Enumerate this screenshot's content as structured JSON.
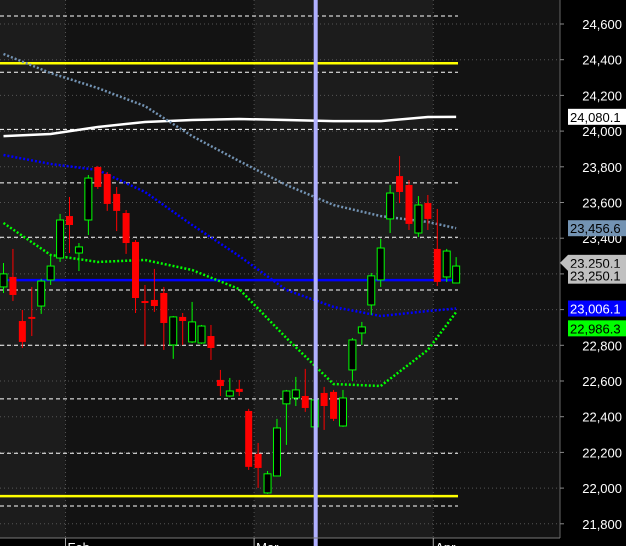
{
  "chart_data": {
    "type": "candlestick",
    "title": "",
    "xlabel": "",
    "ylabel": "",
    "ylim": [
      21730,
      24735
    ],
    "y_ticks": [
      "24,600",
      "24,400",
      "24,200",
      "24,000",
      "23,800",
      "23,600",
      "23,400",
      "23,200",
      "23,000",
      "22,800",
      "22,600",
      "22,400",
      "22,200",
      "22,000",
      "21,800"
    ],
    "y_tick_values": [
      24600,
      24400,
      24200,
      24000,
      23800,
      23600,
      23400,
      23200,
      23000,
      22800,
      22600,
      22400,
      22200,
      22000,
      21800
    ],
    "month_labels": [
      {
        "label": "Feb",
        "index": 7
      },
      {
        "label": "Mar",
        "index": 27
      },
      {
        "label": "Apr",
        "index": 46
      }
    ],
    "candles": [
      {
        "o": 23127,
        "h": 23261,
        "l": 23093,
        "c": 23200
      },
      {
        "o": 23183,
        "h": 23340,
        "l": 23048,
        "c": 23082
      },
      {
        "o": 22936,
        "h": 22998,
        "l": 22785,
        "c": 22819
      },
      {
        "o": 22959,
        "h": 23127,
        "l": 22852,
        "c": 22948
      },
      {
        "o": 23020,
        "h": 23172,
        "l": 22976,
        "c": 23160
      },
      {
        "o": 23166,
        "h": 23306,
        "l": 23138,
        "c": 23244
      },
      {
        "o": 23289,
        "h": 23536,
        "l": 23267,
        "c": 23502
      },
      {
        "o": 23524,
        "h": 23631,
        "l": 23317,
        "c": 23474
      },
      {
        "o": 23317,
        "h": 23373,
        "l": 23216,
        "c": 23351
      },
      {
        "o": 23502,
        "h": 23754,
        "l": 23418,
        "c": 23737
      },
      {
        "o": 23799,
        "h": 23805,
        "l": 23676,
        "c": 23687
      },
      {
        "o": 23760,
        "h": 23771,
        "l": 23553,
        "c": 23592
      },
      {
        "o": 23648,
        "h": 23687,
        "l": 23440,
        "c": 23553
      },
      {
        "o": 23541,
        "h": 23558,
        "l": 23312,
        "c": 23373
      },
      {
        "o": 23379,
        "h": 23390,
        "l": 22981,
        "c": 23065
      },
      {
        "o": 23048,
        "h": 23138,
        "l": 22796,
        "c": 23037
      },
      {
        "o": 23054,
        "h": 23228,
        "l": 22987,
        "c": 23020
      },
      {
        "o": 23093,
        "h": 23127,
        "l": 22774,
        "c": 22925
      },
      {
        "o": 22802,
        "h": 22964,
        "l": 22724,
        "c": 22959
      },
      {
        "o": 22959,
        "h": 22981,
        "l": 22802,
        "c": 22936
      },
      {
        "o": 22819,
        "h": 23043,
        "l": 22813,
        "c": 22931
      },
      {
        "o": 22813,
        "h": 22914,
        "l": 22808,
        "c": 22908
      },
      {
        "o": 22852,
        "h": 22914,
        "l": 22718,
        "c": 22785
      },
      {
        "o": 22606,
        "h": 22662,
        "l": 22516,
        "c": 22572
      },
      {
        "o": 22516,
        "h": 22617,
        "l": 22511,
        "c": 22544
      },
      {
        "o": 22556,
        "h": 22606,
        "l": 22516,
        "c": 22539
      },
      {
        "o": 22432,
        "h": 22444,
        "l": 22102,
        "c": 22119
      },
      {
        "o": 22192,
        "h": 22253,
        "l": 22001,
        "c": 22113
      },
      {
        "o": 21973,
        "h": 22096,
        "l": 21968,
        "c": 22080
      },
      {
        "o": 22068,
        "h": 22388,
        "l": 22068,
        "c": 22337
      },
      {
        "o": 22472,
        "h": 22550,
        "l": 22242,
        "c": 22544
      },
      {
        "o": 22505,
        "h": 22623,
        "l": 22460,
        "c": 22550
      },
      {
        "o": 22516,
        "h": 22668,
        "l": 22427,
        "c": 22449
      },
      {
        "o": 22343,
        "h": 22516,
        "l": 22315,
        "c": 22494
      },
      {
        "o": 22533,
        "h": 22567,
        "l": 22326,
        "c": 22460
      },
      {
        "o": 22539,
        "h": 22550,
        "l": 22376,
        "c": 22388
      },
      {
        "o": 22348,
        "h": 22550,
        "l": 22343,
        "c": 22505
      },
      {
        "o": 22662,
        "h": 22841,
        "l": 22600,
        "c": 22830
      },
      {
        "o": 22869,
        "h": 22931,
        "l": 22802,
        "c": 22903
      },
      {
        "o": 23026,
        "h": 23205,
        "l": 22970,
        "c": 23189
      },
      {
        "o": 23166,
        "h": 23396,
        "l": 23127,
        "c": 23345
      },
      {
        "o": 23508,
        "h": 23698,
        "l": 23429,
        "c": 23653
      },
      {
        "o": 23748,
        "h": 23860,
        "l": 23597,
        "c": 23659
      },
      {
        "o": 23698,
        "h": 23726,
        "l": 23446,
        "c": 23480
      },
      {
        "o": 23429,
        "h": 23636,
        "l": 23407,
        "c": 23586
      },
      {
        "o": 23597,
        "h": 23642,
        "l": 23446,
        "c": 23508
      },
      {
        "o": 23340,
        "h": 23564,
        "l": 23132,
        "c": 23155
      },
      {
        "o": 23183,
        "h": 23340,
        "l": 23155,
        "c": 23328
      },
      {
        "o": 23149,
        "h": 23294,
        "l": 23149,
        "c": 23244
      }
    ],
    "ma_sample_indices": [
      0,
      5,
      10,
      15,
      20,
      25,
      30,
      35,
      40,
      45,
      48
    ],
    "moving_averages": [
      {
        "name": "ma-white",
        "color": "#ffffff",
        "style": "solid",
        "values": [
          23972,
          23984,
          24023,
          24051,
          24062,
          24068,
          24062,
          24056,
          24056,
          24079,
          24080
        ]
      },
      {
        "name": "ma-steelblue",
        "color": "#7393b3",
        "style": "dotted",
        "values": [
          24432,
          24325,
          24241,
          24140,
          23972,
          23832,
          23698,
          23586,
          23524,
          23491,
          23456
        ]
      },
      {
        "name": "ma-blue",
        "color": "#0000ff",
        "style": "dotted",
        "values": [
          23866,
          23816,
          23782,
          23659,
          23474,
          23300,
          23110,
          23015,
          22964,
          22992,
          23006
        ]
      },
      {
        "name": "ma-green",
        "color": "#00ff00",
        "style": "dotted",
        "values": [
          23485,
          23306,
          23267,
          23278,
          23222,
          23115,
          22841,
          22583,
          22572,
          22774,
          22986
        ]
      }
    ],
    "horizontal_lines": [
      {
        "name": "yellow-upper",
        "price": 24380,
        "color": "#ffff00"
      },
      {
        "name": "yellow-lower",
        "price": 21955,
        "color": "#ffff00"
      },
      {
        "name": "blue-support",
        "price": 23165,
        "color": "#0000ff"
      }
    ],
    "dashed_levels": [
      24645,
      24330,
      24010,
      23710,
      23405,
      23110,
      22800,
      22500,
      22195,
      21900
    ],
    "cursor_index": 33,
    "price_labels": [
      {
        "text": "24,080.1",
        "price": 24080,
        "bg": "#ffffff",
        "fg": "#000000"
      },
      {
        "text": "23,456.6",
        "price": 23456,
        "bg": "#7393b3",
        "fg": "#000000"
      },
      {
        "text": "23,250.1",
        "price": 23262,
        "bg": "#c0c0c0",
        "fg": "#000000",
        "arrow": true
      },
      {
        "text": "23,250.1",
        "price": 23190,
        "bg": "#c0c0c0",
        "fg": "#000000"
      },
      {
        "text": "23,006.1",
        "price": 23006,
        "bg": "#0000ff",
        "fg": "#ffffff"
      },
      {
        "text": "22,986.3",
        "price": 22895,
        "bg": "#00ff00",
        "fg": "#000000"
      }
    ],
    "colors": {
      "up": "#00ff00",
      "down": "#ff0000",
      "cursor": "#b0b0ff"
    }
  }
}
